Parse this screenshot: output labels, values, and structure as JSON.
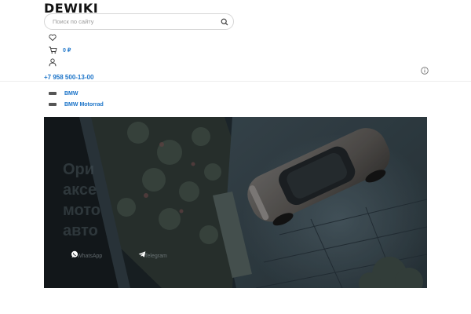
{
  "header": {
    "logo": "DEWIKI",
    "search": {
      "placeholder": "Поиск по сайту"
    },
    "cart_total": "0 ₽",
    "phone": "+7 958 500-13-00"
  },
  "brands": [
    {
      "label": "BMW"
    },
    {
      "label": "BMW Motorrad"
    }
  ],
  "hero": {
    "title_lines": [
      "Ори",
      "аксе",
      "мото",
      "авто"
    ],
    "contacts": [
      {
        "label": "WhatsApp",
        "icon": "whatsapp-icon"
      },
      {
        "label": "Telegram",
        "icon": "telegram-icon"
      }
    ]
  },
  "colors": {
    "link": "#1a73c8",
    "hero_dark": "#1c2226"
  }
}
